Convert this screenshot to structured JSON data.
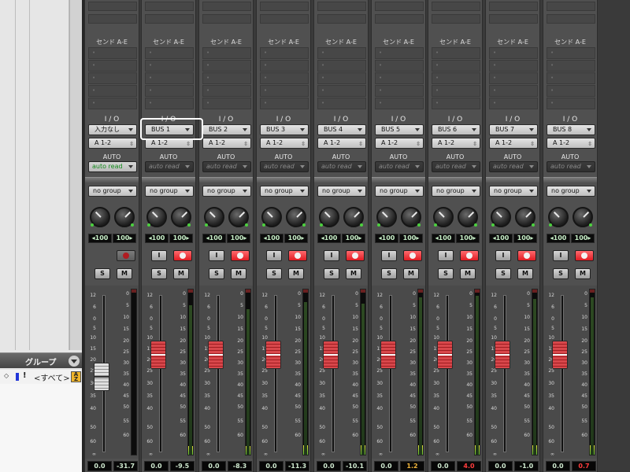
{
  "group_panel": {
    "title": "グループ",
    "menu_icon": "chevron-down-icon",
    "row": {
      "marker": "◇",
      "flag": "!",
      "name": "<すべて>",
      "sort_icon": "a-z-sort-icon",
      "sort_label": "A\nZ"
    }
  },
  "labels": {
    "send": "センド A-E",
    "io": "I / O",
    "auto": "AUTO"
  },
  "channels": [
    {
      "input": "入力なし",
      "output": "A 1-2",
      "auto": "auto read",
      "auto_active": true,
      "group": "no group",
      "pan_l": "◂100",
      "pan_r": "100▸",
      "input_monitor": false,
      "rec_state": "disabled",
      "solo": "S",
      "mute": "M",
      "fader_style": "grey",
      "fader_level": 0.48,
      "meter_level": 0.0,
      "volume": "0.0",
      "peak": "-31.7",
      "peak_color": "normal"
    },
    {
      "input": "BUS 1",
      "output": "A 1-2",
      "auto": "auto read",
      "auto_active": false,
      "group": "no group",
      "pan_l": "◂100",
      "pan_r": "100▸",
      "input_monitor": true,
      "input_monitor_label": "I",
      "rec_state": "armed",
      "solo": "S",
      "mute": "M",
      "fader_style": "red",
      "fader_level": 0.62,
      "meter_level": 0.92,
      "volume": "0.0",
      "peak": "-9.5",
      "peak_color": "normal"
    },
    {
      "input": "BUS 2",
      "output": "A 1-2",
      "auto": "auto read",
      "auto_active": false,
      "group": "no group",
      "pan_l": "◂100",
      "pan_r": "100▸",
      "input_monitor": true,
      "input_monitor_label": "I",
      "rec_state": "armed",
      "solo": "S",
      "mute": "M",
      "fader_style": "red",
      "fader_level": 0.62,
      "meter_level": 0.9,
      "volume": "0.0",
      "peak": "-8.3",
      "peak_color": "normal"
    },
    {
      "input": "BUS 3",
      "output": "A 1-2",
      "auto": "auto read",
      "auto_active": false,
      "group": "no group",
      "pan_l": "◂100",
      "pan_r": "100▸",
      "input_monitor": true,
      "input_monitor_label": "I",
      "rec_state": "armed",
      "solo": "S",
      "mute": "M",
      "fader_style": "red",
      "fader_level": 0.62,
      "meter_level": 0.94,
      "volume": "0.0",
      "peak": "-11.3",
      "peak_color": "normal"
    },
    {
      "input": "BUS 4",
      "output": "A 1-2",
      "auto": "auto read",
      "auto_active": false,
      "group": "no group",
      "pan_l": "◂100",
      "pan_r": "100▸",
      "input_monitor": true,
      "input_monitor_label": "I",
      "rec_state": "armed",
      "solo": "S",
      "mute": "M",
      "fader_style": "red",
      "fader_level": 0.62,
      "meter_level": 0.93,
      "volume": "0.0",
      "peak": "-10.1",
      "peak_color": "normal"
    },
    {
      "input": "BUS 5",
      "output": "A 1-2",
      "auto": "auto read",
      "auto_active": false,
      "group": "no group",
      "pan_l": "◂100",
      "pan_r": "100▸",
      "input_monitor": true,
      "input_monitor_label": "I",
      "rec_state": "armed",
      "solo": "S",
      "mute": "M",
      "fader_style": "red",
      "fader_level": 0.62,
      "meter_level": 0.97,
      "volume": "0.0",
      "peak": "1.2",
      "peak_color": "amber"
    },
    {
      "input": "BUS 6",
      "output": "A 1-2",
      "auto": "auto read",
      "auto_active": false,
      "group": "no group",
      "pan_l": "◂100",
      "pan_r": "100▸",
      "input_monitor": true,
      "input_monitor_label": "I",
      "rec_state": "armed",
      "solo": "S",
      "mute": "M",
      "fader_style": "red",
      "fader_level": 0.62,
      "meter_level": 0.98,
      "volume": "0.0",
      "peak": "4.0",
      "peak_color": "red"
    },
    {
      "input": "BUS 7",
      "output": "A 1-2",
      "auto": "auto read",
      "auto_active": false,
      "group": "no group",
      "pan_l": "◂100",
      "pan_r": "100▸",
      "input_monitor": true,
      "input_monitor_label": "I",
      "rec_state": "armed",
      "solo": "S",
      "mute": "M",
      "fader_style": "red",
      "fader_level": 0.62,
      "meter_level": 0.96,
      "volume": "0.0",
      "peak": "-1.0",
      "peak_color": "normal"
    },
    {
      "input": "BUS 8",
      "output": "A 1-2",
      "auto": "auto read",
      "auto_active": false,
      "group": "no group",
      "pan_l": "◂100",
      "pan_r": "100▸",
      "input_monitor": true,
      "input_monitor_label": "I",
      "rec_state": "armed",
      "solo": "S",
      "mute": "M",
      "fader_style": "red",
      "fader_level": 0.62,
      "meter_level": 0.97,
      "volume": "0.0",
      "peak": "0.7",
      "peak_color": "red"
    }
  ],
  "fader_scale": [
    "12",
    "6",
    "0",
    "5",
    "10",
    "15",
    "20",
    "25",
    "30",
    "35",
    "40",
    "50",
    "60",
    "∞"
  ],
  "meter_scale": [
    "0",
    "5",
    "10",
    "15",
    "20",
    "25",
    "30",
    "35",
    "40",
    "45",
    "50",
    "55",
    "60"
  ],
  "output_stepper_glyph": "⇳",
  "send_bullet": "•",
  "selected_input_channel": 1,
  "colors": {
    "record": "#e8242a",
    "meter_green": "#5fbc2d",
    "meter_yellow": "#e2dd3c",
    "peak_amber": "#f0b43a",
    "peak_red": "#ff3c3c",
    "group_swatch": "#2236d8"
  }
}
